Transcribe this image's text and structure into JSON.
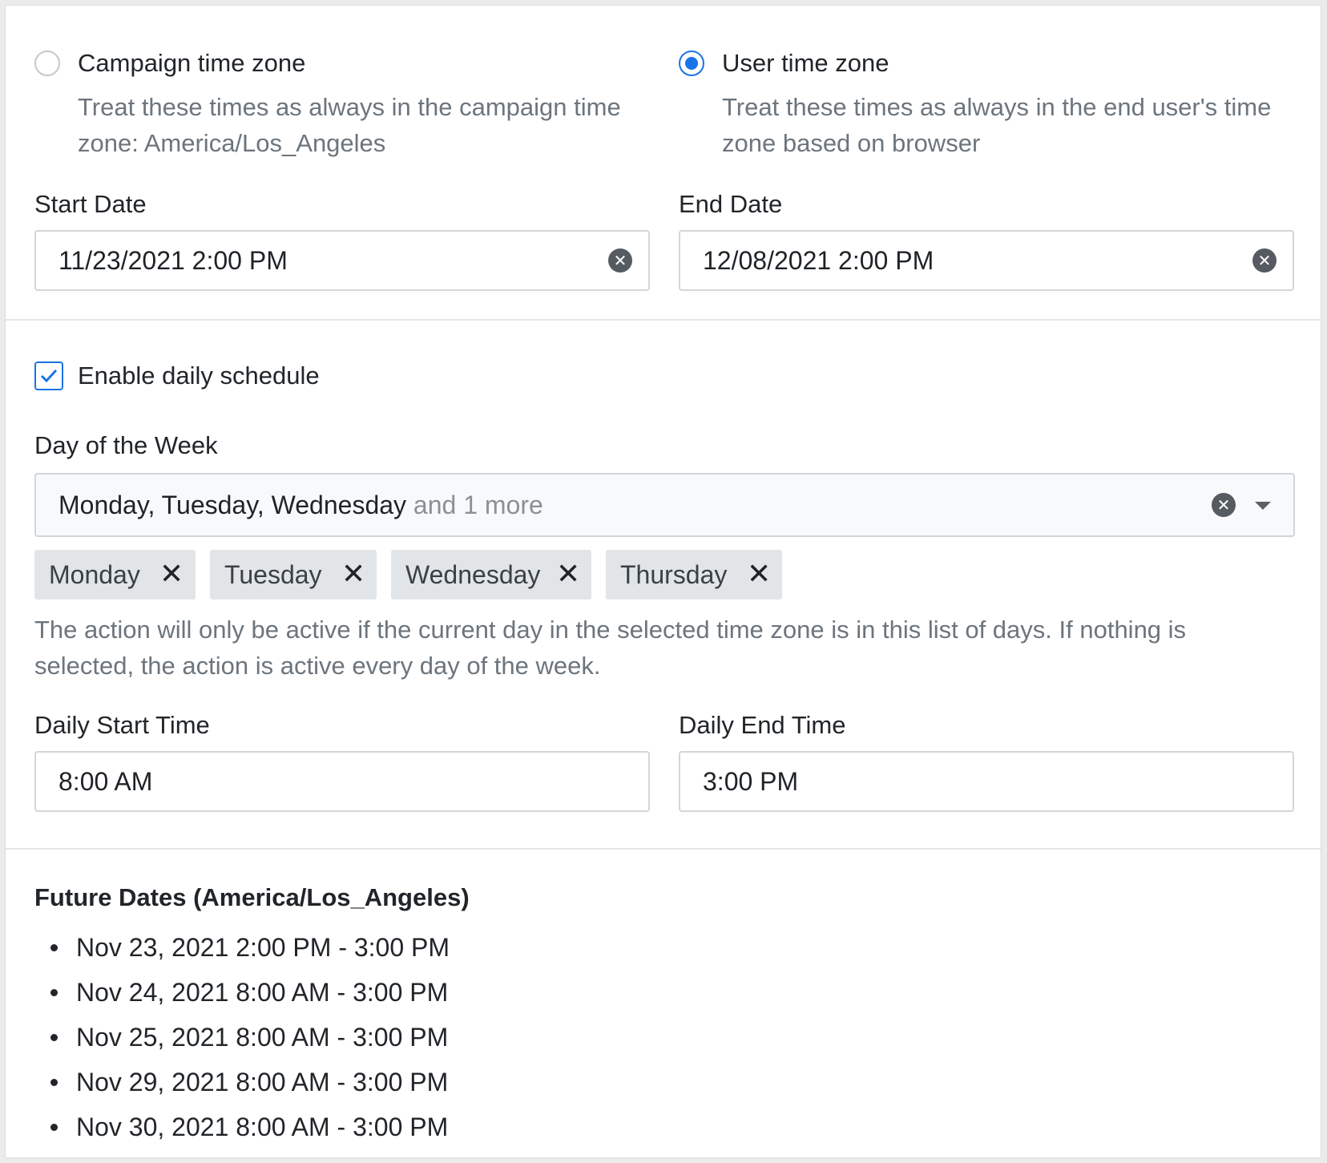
{
  "timezone": {
    "campaign": {
      "label": "Campaign time zone",
      "help": "Treat these times as always in the campaign time zone: America/Los_Angeles",
      "checked": false
    },
    "user": {
      "label": "User time zone",
      "help": "Treat these times as always in the end user's time zone based on browser",
      "checked": true
    }
  },
  "dates": {
    "start_label": "Start Date",
    "start_value": "11/23/2021 2:00 PM",
    "end_label": "End Date",
    "end_value": "12/08/2021 2:00 PM"
  },
  "schedule": {
    "enable_label": "Enable daily schedule",
    "enabled": true,
    "day_label": "Day of the Week",
    "day_selected": "Monday, Tuesday, Wednesday",
    "day_more": "and 1 more",
    "chips": [
      "Monday",
      "Tuesday",
      "Wednesday",
      "Thursday"
    ],
    "help": "The action will only be active if the current day in the selected time zone is in this list of days. If nothing is selected, the action is active every day of the week.",
    "daily_start_label": "Daily Start Time",
    "daily_start_value": "8:00 AM",
    "daily_end_label": "Daily End Time",
    "daily_end_value": "3:00 PM"
  },
  "future": {
    "title": "Future Dates (America/Los_Angeles)",
    "items": [
      "Nov 23, 2021 2:00 PM - 3:00 PM",
      "Nov 24, 2021 8:00 AM - 3:00 PM",
      "Nov 25, 2021 8:00 AM - 3:00 PM",
      "Nov 29, 2021 8:00 AM - 3:00 PM",
      "Nov 30, 2021 8:00 AM - 3:00 PM"
    ]
  },
  "colors": {
    "accent": "#1a73e8",
    "muted_text": "#6c757d",
    "chip_bg": "#e2e5e8"
  }
}
